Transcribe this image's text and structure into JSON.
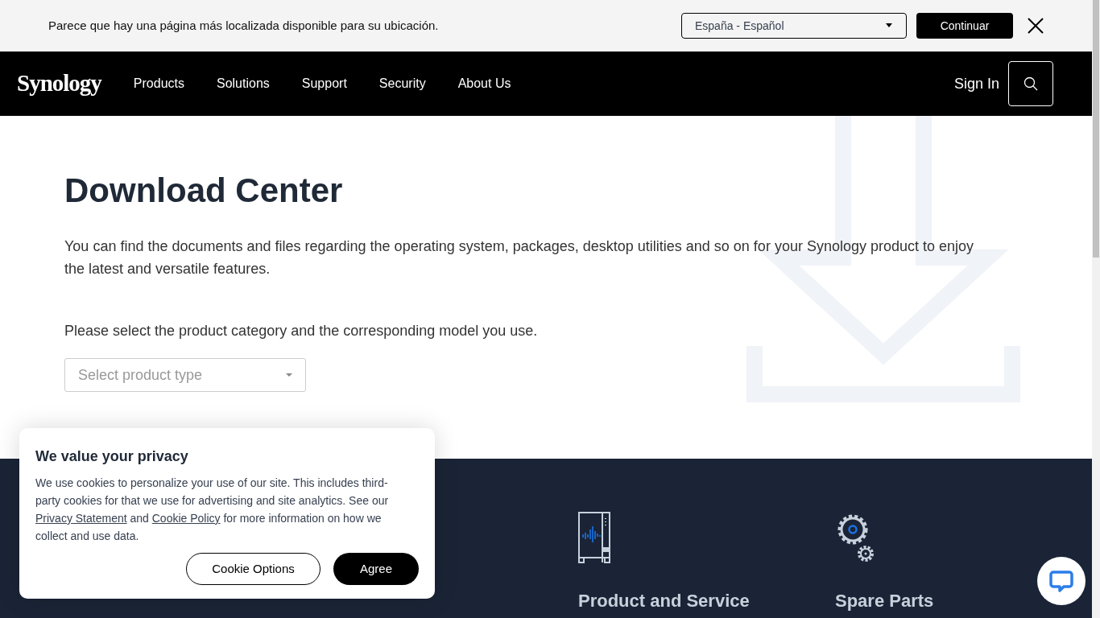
{
  "locale_banner": {
    "message": "Parece que hay una página más localizada disponible para su ubicación.",
    "region_select": {
      "value": "España - Español"
    },
    "continue_button": "Continuar"
  },
  "nav": {
    "logo": "Synology",
    "items": [
      "Products",
      "Solutions",
      "Support",
      "Security",
      "About Us"
    ],
    "sign_in": "Sign In"
  },
  "hero": {
    "title": "Download Center",
    "description": "You can find the documents and files regarding the operating system, packages, desktop utilities and so on for your Synology product to enjoy the latest and versatile features.",
    "prompt": "Please select the product category and the corresponding model you use.",
    "product_select": {
      "placeholder": "Select product type"
    }
  },
  "footer_columns": [
    {
      "kind": "device",
      "title": "Product and Service"
    },
    {
      "kind": "gears",
      "title": "Spare Parts"
    }
  ],
  "cookie_notice": {
    "title": "We value your privacy",
    "text_before": "We use cookies to personalize your use of our site. This includes third-party cookies for that we use for advertising and site analytics. See our",
    "privacy_link": "Privacy Statement",
    "middle": "and",
    "cookie_link": "Cookie Policy",
    "text_after": "for more information on how we collect and use data.",
    "buttons": [
      {
        "kind": "outline",
        "label": "Cookie Options"
      },
      {
        "kind": "solid",
        "label": "Agree"
      }
    ]
  }
}
